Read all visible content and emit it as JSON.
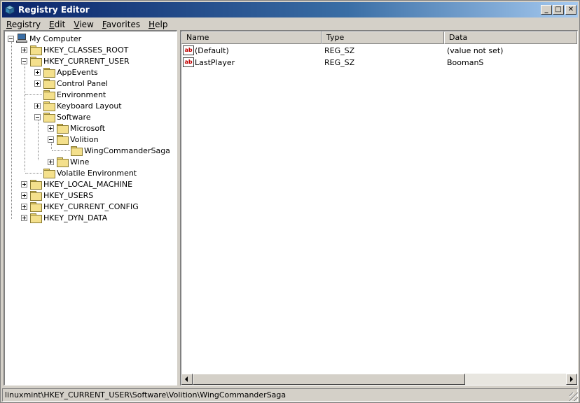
{
  "window": {
    "title": "Registry Editor",
    "buttons": {
      "minimize": "_",
      "maximize": "□",
      "close": "✕"
    }
  },
  "menubar": {
    "items": [
      {
        "acc": "R",
        "rest": "egistry"
      },
      {
        "acc": "E",
        "rest": "dit"
      },
      {
        "acc": "V",
        "rest": "iew"
      },
      {
        "acc": "F",
        "rest": "avorites"
      },
      {
        "acc": "H",
        "rest": "elp"
      }
    ]
  },
  "tree": {
    "root": "My Computer",
    "nodes": [
      {
        "label": "HKEY_CLASSES_ROOT"
      },
      {
        "label": "HKEY_CURRENT_USER"
      },
      {
        "label": "AppEvents"
      },
      {
        "label": "Control Panel"
      },
      {
        "label": "Environment"
      },
      {
        "label": "Keyboard Layout"
      },
      {
        "label": "Software"
      },
      {
        "label": "Microsoft"
      },
      {
        "label": "Volition"
      },
      {
        "label": "WingCommanderSaga"
      },
      {
        "label": "Wine"
      },
      {
        "label": "Volatile Environment"
      },
      {
        "label": "HKEY_LOCAL_MACHINE"
      },
      {
        "label": "HKEY_USERS"
      },
      {
        "label": "HKEY_CURRENT_CONFIG"
      },
      {
        "label": "HKEY_DYN_DATA"
      }
    ]
  },
  "values": {
    "columns": {
      "name": "Name",
      "type": "Type",
      "data": "Data"
    },
    "icon_text": "ab",
    "rows": [
      {
        "name": "(Default)",
        "type": "REG_SZ",
        "data": "(value not set)"
      },
      {
        "name": "LastPlayer",
        "type": "REG_SZ",
        "data": "BoomanS"
      }
    ]
  },
  "statusbar": {
    "path": "linuxmint\\HKEY_CURRENT_USER\\Software\\Volition\\WingCommanderSaga"
  }
}
